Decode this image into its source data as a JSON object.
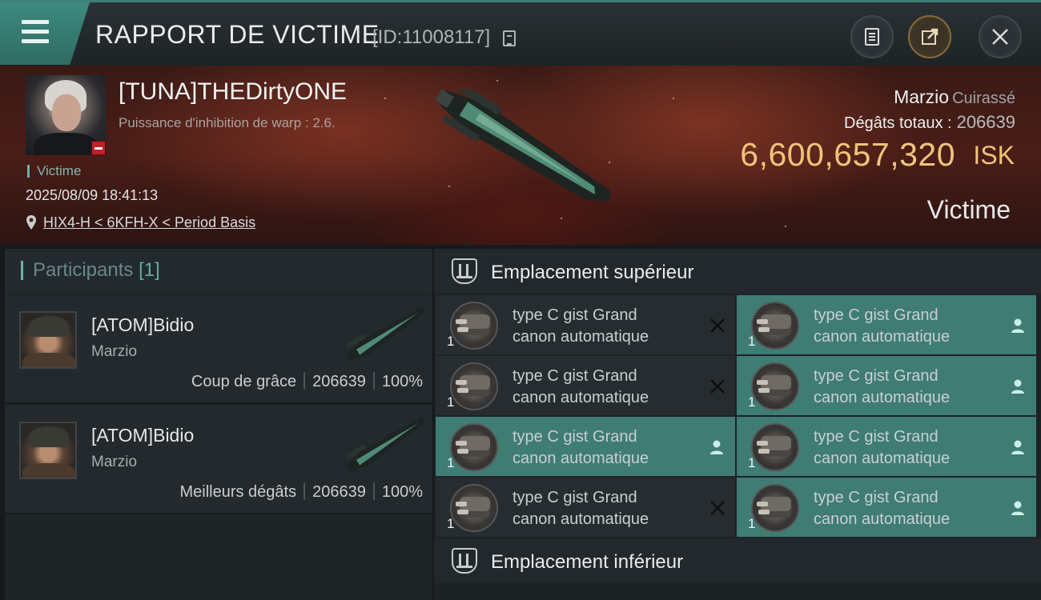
{
  "header": {
    "title": "RAPPORT DE VICTIME",
    "report_id": "[ID:11008117]",
    "icons": [
      "menu-icon",
      "copy-icon",
      "report-icon",
      "share-icon",
      "close-icon"
    ]
  },
  "victim": {
    "name": "[TUNA]THEDirtyONE",
    "warp_info": "Puissance d'inhibition de warp : 2.6.",
    "tag": "Victime",
    "datetime": "2025/08/09 18:41:13",
    "location": "HIX4-H < 6KFH-X < Period Basis",
    "ship_name": "Marzio",
    "ship_class": "Cuirassé",
    "total_damage_label": "Dégâts totaux :",
    "total_damage": "206639",
    "isk_value": "6,600,657,320",
    "isk_unit": "ISK",
    "role_label": "Victime"
  },
  "participants": {
    "label": "Participants",
    "count": "[1]",
    "rows": [
      {
        "name": "[ATOM]Bidio",
        "ship": "Marzio",
        "tag": "Coup de grâce",
        "damage": "206639",
        "percent": "100%"
      },
      {
        "name": "[ATOM]Bidio",
        "ship": "Marzio",
        "tag": "Meilleurs dégâts",
        "damage": "206639",
        "percent": "100%"
      }
    ]
  },
  "slots": {
    "high_title": "Emplacement supérieur",
    "low_title": "Emplacement inférieur",
    "high": [
      {
        "line1": "type C gist Grand",
        "line2": "canon automatique",
        "qty": "1",
        "state": "destroyed"
      },
      {
        "line1": "type C gist Grand",
        "line2": "canon automatique",
        "qty": "1",
        "state": "dropped"
      },
      {
        "line1": "type C gist Grand",
        "line2": "canon automatique",
        "qty": "1",
        "state": "destroyed"
      },
      {
        "line1": "type C gist Grand",
        "line2": "canon automatique",
        "qty": "1",
        "state": "dropped"
      },
      {
        "line1": "type C gist Grand",
        "line2": "canon automatique",
        "qty": "1",
        "state": "dropped"
      },
      {
        "line1": "type C gist Grand",
        "line2": "canon automatique",
        "qty": "1",
        "state": "dropped"
      },
      {
        "line1": "type C gist Grand",
        "line2": "canon automatique",
        "qty": "1",
        "state": "destroyed"
      },
      {
        "line1": "type C gist Grand",
        "line2": "canon automatique",
        "qty": "1",
        "state": "dropped"
      }
    ]
  },
  "colors": {
    "accent": "#3f7c73",
    "isk": "#f0c47a",
    "banner": "#4a1d17"
  }
}
